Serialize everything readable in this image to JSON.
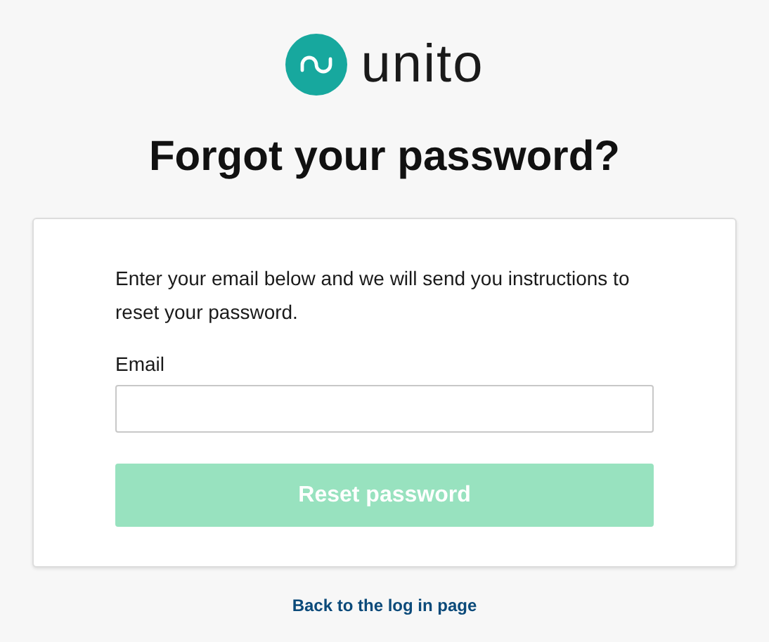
{
  "logo": {
    "wordmark": "unito"
  },
  "title": "Forgot your password?",
  "form": {
    "instructions": "Enter your email below and we will send you instructions to reset your password.",
    "email_label": "Email",
    "submit": {
      "label": "Reset password",
      "disabled": true
    }
  },
  "back_link": "Back to the log in page"
}
